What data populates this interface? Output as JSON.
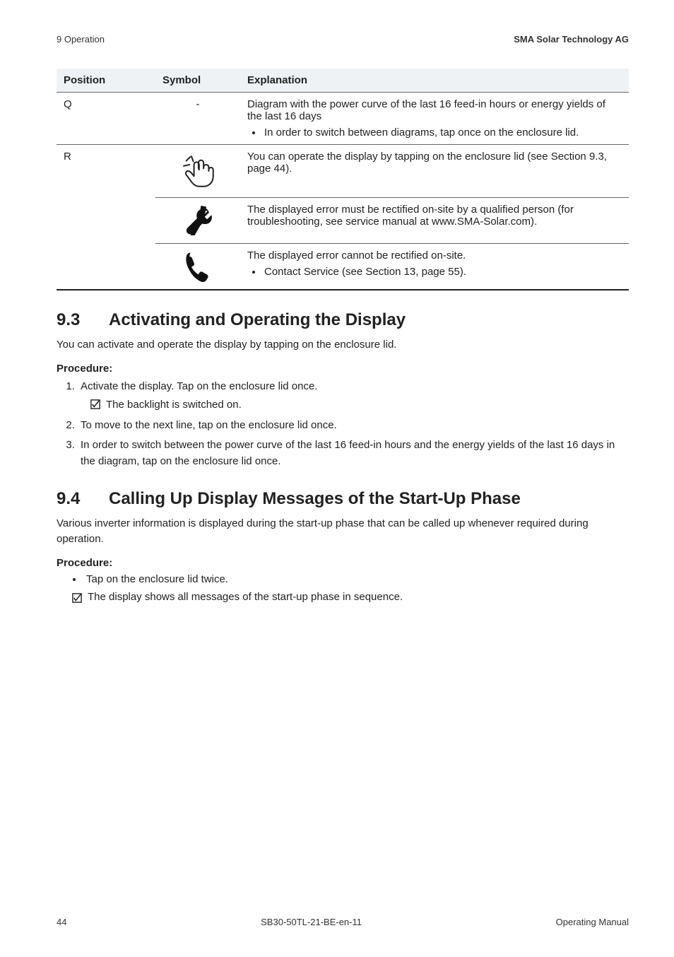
{
  "header": {
    "left": "9 Operation",
    "right": "SMA Solar Technology AG"
  },
  "table": {
    "headers": {
      "position": "Position",
      "symbol": "Symbol",
      "explanation": "Explanation"
    },
    "rowQ": {
      "position": "Q",
      "symbol_dash": "-",
      "explanation": "Diagram with the power curve of the last 16 feed-in hours or energy yields of the last 16 days",
      "bullet": "In order to switch between diagrams, tap once on the enclosure lid."
    },
    "rowR1": {
      "position": "R",
      "icon": "tap-icon",
      "explanation": "You can operate the display by tapping on the enclosure lid (see Section 9.3, page 44)."
    },
    "rowR2": {
      "icon": "wrench-icon",
      "explanation": "The displayed error must be rectified on-site by a qualified person (for troubleshooting, see service manual at www.SMA-Solar.com)."
    },
    "rowR3": {
      "icon": "phone-icon",
      "explanation": "The displayed error cannot be rectified on-site.",
      "bullet": "Contact Service (see Section 13, page 55)."
    }
  },
  "section93": {
    "num": "9.3",
    "title": "Activating and Operating the Display",
    "intro": "You can activate and operate the display by tapping on the enclosure lid.",
    "procedure_label": "Procedure:",
    "step1": "Activate the display. Tap on the enclosure lid once.",
    "step1_result": "The backlight is switched on.",
    "step2": "To move to the next line, tap on the enclosure lid once.",
    "step3": "In order to switch between the power curve of the last 16 feed-in hours and the energy yields of the last 16 days in the diagram, tap on the enclosure lid once."
  },
  "section94": {
    "num": "9.4",
    "title": "Calling Up Display Messages of the Start-Up Phase",
    "intro": "Various inverter information is displayed during the start-up phase that can be called up whenever required during operation.",
    "procedure_label": "Procedure:",
    "bullet": "Tap on the enclosure lid twice.",
    "result": "The display shows all messages of the start-up phase in sequence."
  },
  "footer": {
    "page": "44",
    "docid": "SB30-50TL-21-BE-en-11",
    "type": "Operating Manual"
  }
}
